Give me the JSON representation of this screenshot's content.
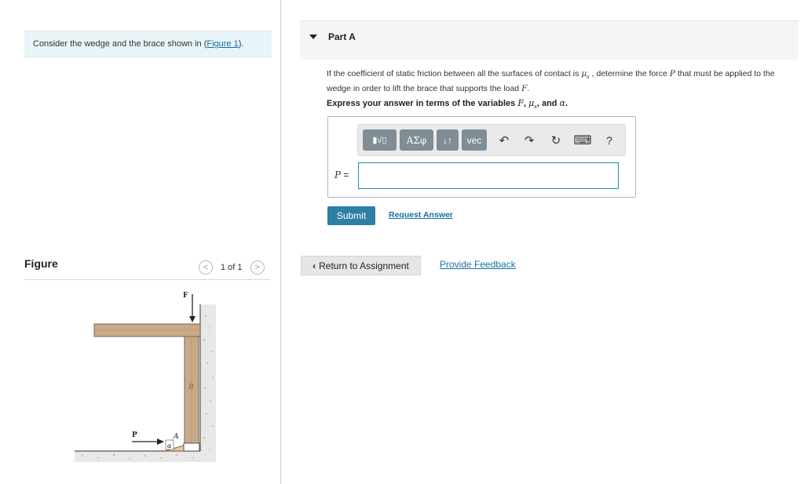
{
  "context": {
    "prefix": "Consider the wedge and the brace shown in (",
    "link": "Figure 1",
    "suffix": ")."
  },
  "figure": {
    "title": "Figure",
    "pager_text": "1 of 1",
    "labels": {
      "F": "F",
      "B": "B",
      "P": "P",
      "A": "A",
      "alpha": "α"
    }
  },
  "part": {
    "label": "Part A",
    "question_1": "If the coefficient of static friction between all the surfaces of contact is ",
    "question_mu": "μ",
    "question_mu_sub": "s",
    "question_2": " , determine the force ",
    "question_P": "P",
    "question_3": " that must be applied to the wedge in order to lift the brace that supports the load ",
    "question_F": "F",
    "question_4": ".",
    "instruction_1": "Express your answer in terms of the variables ",
    "instruction_F": "F",
    "instruction_mu": "μ",
    "instruction_mu_sub": "s",
    "instruction_and": ", and ",
    "instruction_alpha": "α",
    "instruction_end": "."
  },
  "toolbar": {
    "templates_label": "▮√▯",
    "greek_label": "ΑΣφ",
    "arrows_label": "↓↑",
    "vec_label": "vec",
    "undo": "↶",
    "redo": "↷",
    "reset": "↻",
    "keyboard": "⌨",
    "help": "?"
  },
  "answer": {
    "var": "P",
    "equals": " =",
    "value": ""
  },
  "buttons": {
    "submit": "Submit",
    "request_answer": "Request Answer",
    "return": "Return to Assignment",
    "feedback": "Provide Feedback"
  }
}
